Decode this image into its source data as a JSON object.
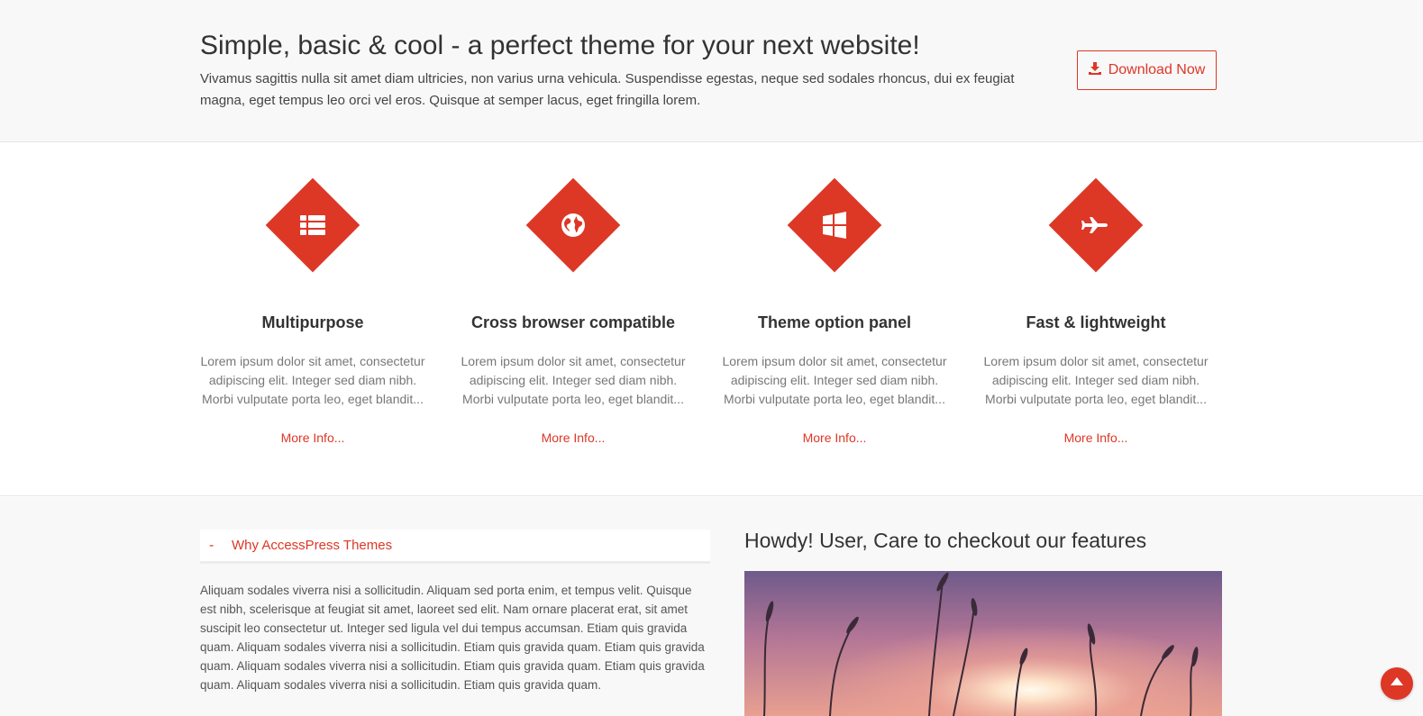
{
  "hero": {
    "title": "Simple, basic & cool - a perfect theme for your next website!",
    "text": "Vivamus sagittis nulla sit amet diam ultricies, non varius urna vehicula. Suspendisse egestas, neque sed sodales rhoncus, dui ex feugiat magna, eget tempus leo orci vel eros. Quisque at semper lacus, eget fringilla lorem.",
    "button_label": "Download Now",
    "button_icon": "download-icon"
  },
  "features": [
    {
      "icon": "list-icon",
      "title": "Multipurpose",
      "text": "Lorem ipsum dolor sit amet, consectetur adipiscing elit. Integer sed diam nibh. Morbi vulputate porta leo, eget blandit...",
      "link": "More Info..."
    },
    {
      "icon": "globe-icon",
      "title": "Cross browser compatible",
      "text": "Lorem ipsum dolor sit amet, consectetur adipiscing elit. Integer sed diam nibh. Morbi vulputate porta leo, eget blandit...",
      "link": "More Info..."
    },
    {
      "icon": "windows-icon",
      "title": "Theme option panel",
      "text": "Lorem ipsum dolor sit amet, consectetur adipiscing elit. Integer sed diam nibh. Morbi vulputate porta leo, eget blandit...",
      "link": "More Info..."
    },
    {
      "icon": "plane-icon",
      "title": "Fast & lightweight",
      "text": "Lorem ipsum dolor sit amet, consectetur adipiscing elit. Integer sed diam nibh. Morbi vulputate porta leo, eget blandit...",
      "link": "More Info..."
    }
  ],
  "accordion": {
    "toggle": "-",
    "title": "Why AccessPress Themes",
    "body": "Aliquam sodales viverra nisi a sollicitudin. Aliquam sed porta enim, et tempus velit. Quisque est nibh, scelerisque at feugiat sit amet, laoreet sed elit. Nam ornare placerat erat, sit amet suscipit leo consectetur ut. Integer sed ligula vel dui tempus accumsan. Etiam quis gravida quam. Aliquam sodales viverra nisi a sollicitudin. Etiam quis gravida quam. Etiam quis gravida quam. Aliquam sodales viverra nisi a sollicitudin. Etiam quis gravida quam. Etiam quis gravida quam. Aliquam sodales viverra nisi a sollicitudin. Etiam quis gravida quam."
  },
  "promo": {
    "title": "Howdy! User, Care to checkout our features"
  },
  "colors": {
    "accent": "#dd3726",
    "band_bg": "#f8f8f8"
  }
}
